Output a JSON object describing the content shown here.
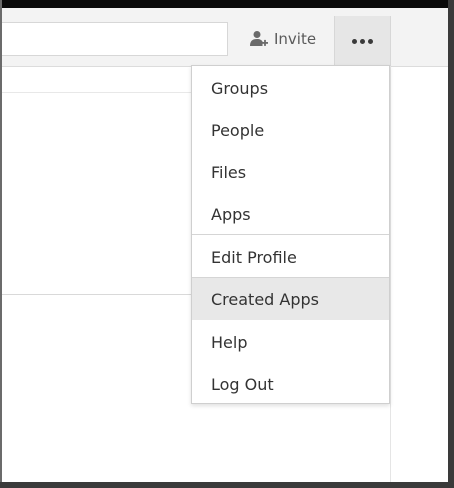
{
  "header": {
    "invite_label": "Invite",
    "invite_icon": "add-user-icon",
    "more_icon": "more-dots-icon"
  },
  "menu": {
    "items": [
      {
        "label": "Groups"
      },
      {
        "label": "People"
      },
      {
        "label": "Files"
      },
      {
        "label": "Apps"
      },
      {
        "label": "Edit Profile"
      },
      {
        "label": "Created Apps"
      },
      {
        "label": "Help"
      },
      {
        "label": "Log Out"
      }
    ],
    "highlighted": "Created Apps"
  },
  "colors": {
    "menu_text": "#333333",
    "highlight_bg": "#e8e8e8",
    "topbar_bg": "#f3f3f3"
  }
}
